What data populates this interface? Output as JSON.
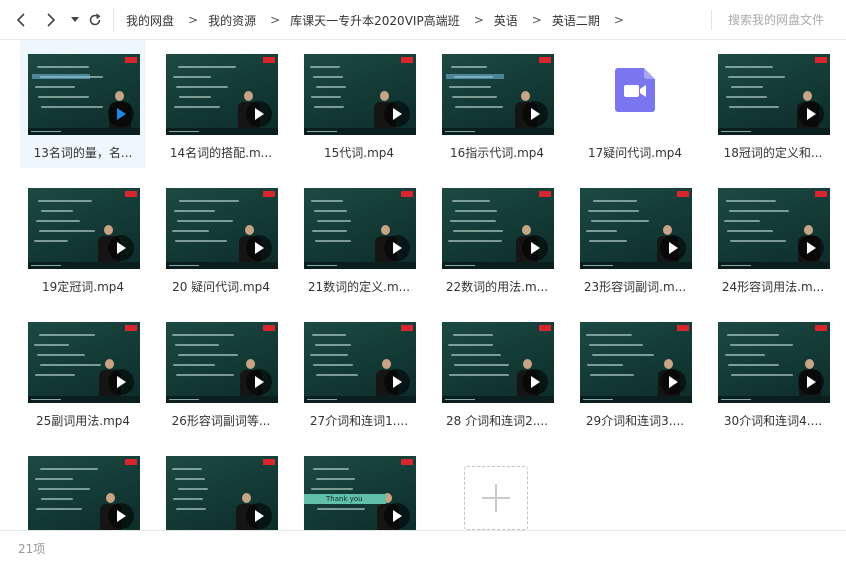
{
  "toolbar": {
    "back_icon": "arrow-left-icon",
    "forward_icon": "arrow-right-icon",
    "dropdown_icon": "caret-down-icon",
    "refresh_icon": "refresh-icon",
    "breadcrumb": [
      {
        "label": "我的网盘"
      },
      {
        "label": "我的资源"
      },
      {
        "label": "库课天一专升本2020VIP高端班"
      },
      {
        "label": "英语"
      },
      {
        "label": "英语二期"
      }
    ],
    "search_placeholder": "搜索我的网盘文件"
  },
  "files": [
    {
      "label": "13名词的量，名...",
      "type": "video-thumb",
      "selected": true,
      "play_icon": "play-blue-icon"
    },
    {
      "label": "14名词的搭配.m...",
      "type": "video-thumb"
    },
    {
      "label": "15代词.mp4",
      "type": "video-thumb"
    },
    {
      "label": "16指示代词.mp4",
      "type": "video-thumb"
    },
    {
      "label": "17疑问代词.mp4",
      "type": "video-file-icon",
      "icon_color": "#7b76f0"
    },
    {
      "label": "18冠词的定义和...",
      "type": "video-thumb"
    },
    {
      "label": "19定冠词.mp4",
      "type": "video-thumb"
    },
    {
      "label": "20 疑问代词.mp4",
      "type": "video-thumb"
    },
    {
      "label": "21数词的定义.m...",
      "type": "video-thumb"
    },
    {
      "label": "22数词的用法.m...",
      "type": "video-thumb"
    },
    {
      "label": "23形容词副词.m...",
      "type": "video-thumb"
    },
    {
      "label": "24形容词用法.m...",
      "type": "video-thumb"
    },
    {
      "label": "25副词用法.mp4",
      "type": "video-thumb"
    },
    {
      "label": "26形容词副词等...",
      "type": "video-thumb"
    },
    {
      "label": "27介词和连词1....",
      "type": "video-thumb"
    },
    {
      "label": "28 介词和连词2....",
      "type": "video-thumb"
    },
    {
      "label": "29介词和连词3....",
      "type": "video-thumb"
    },
    {
      "label": "30介词和连词4....",
      "type": "video-thumb"
    },
    {
      "label": "",
      "type": "video-thumb"
    },
    {
      "label": "",
      "type": "video-thumb"
    },
    {
      "label": "",
      "type": "video-thumb",
      "thumb_text": "Thank you"
    }
  ],
  "new_folder_icon": "plus-icon",
  "status": {
    "item_count": "21项"
  },
  "colors": {
    "accent": "#1e88e5",
    "selected_bg": "#eef6fe",
    "video_icon": "#7b76f0"
  }
}
